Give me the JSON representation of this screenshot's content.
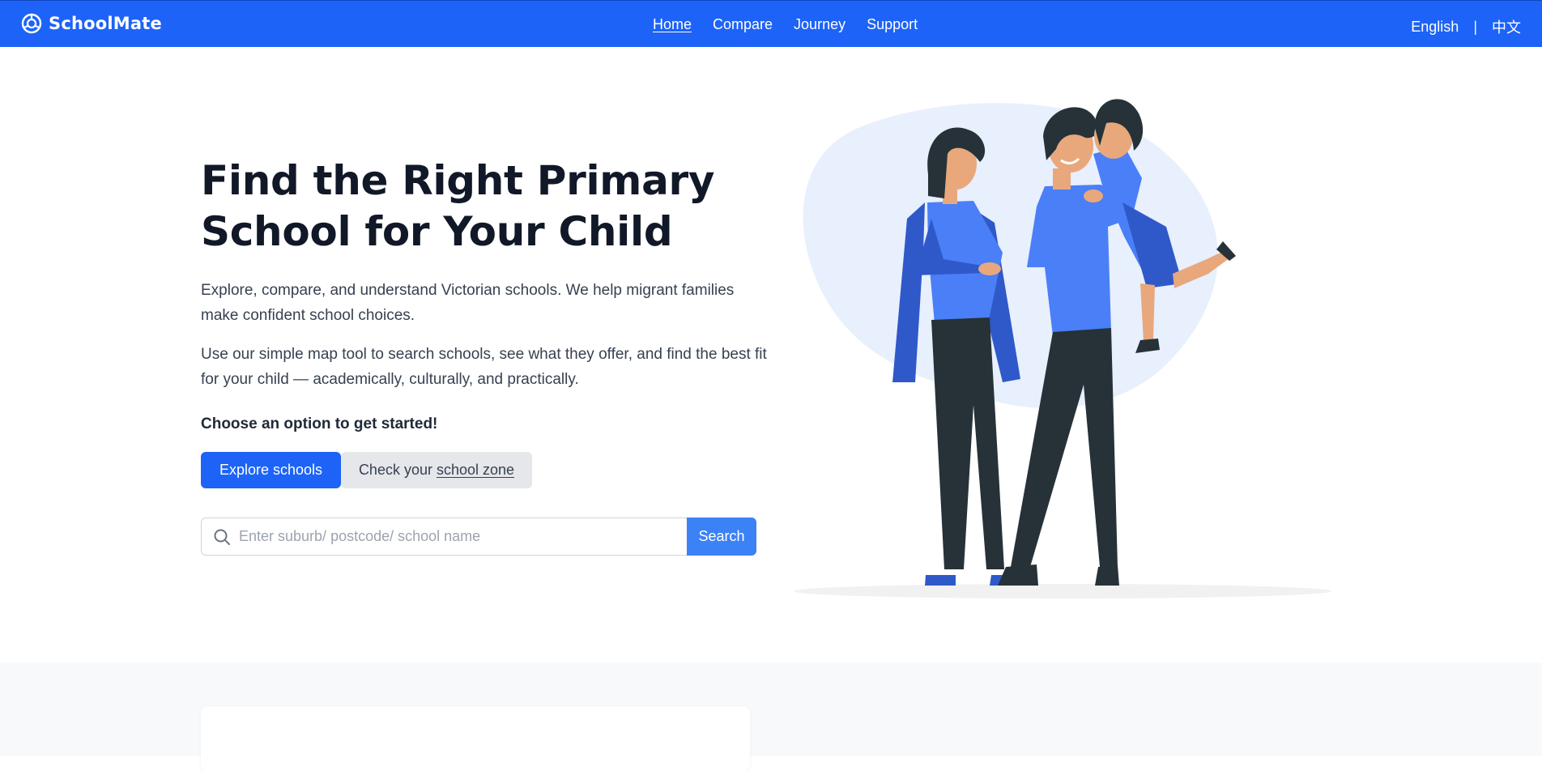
{
  "nav": {
    "brand": "SchoolMate",
    "links": [
      "Home",
      "Compare",
      "Journey",
      "Support"
    ],
    "lang_english": "English",
    "lang_separator": "|",
    "lang_chinese": "中文"
  },
  "hero": {
    "title": "Find the Right Primary School for Your Child",
    "paragraph_1": "Explore, compare, and understand Victorian schools. We help migrant families make confident school choices.",
    "paragraph_2": "Use our simple map tool to search schools, see what they offer, and find the best fit for your child — academically, culturally, and practically.",
    "cta_label": "Choose an option to get started!",
    "explore_button": "Explore schools",
    "zone_button_prefix": "Check your ",
    "zone_button_link": "school zone"
  },
  "search": {
    "placeholder": "Enter suburb/ postcode/ school name",
    "value": "",
    "button": "Search"
  },
  "icons": {
    "brand": "compass-logo-icon",
    "search": "magnifier-icon"
  },
  "colors": {
    "primary": "#1d63f7",
    "search_button": "#3b82f6",
    "secondary_button": "#e5e7eb",
    "illustration_blob": "#e8effd",
    "shirt": "#4a7ff7",
    "pants": "#263238",
    "skin": "#e8a87c"
  }
}
